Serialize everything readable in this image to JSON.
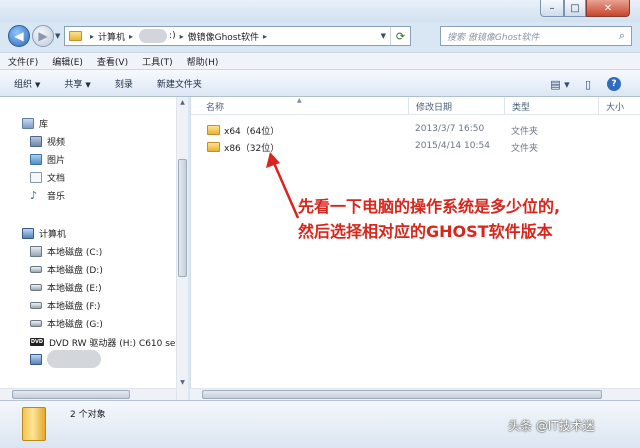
{
  "window": {
    "controls": {
      "minimize": "–",
      "maximize": "□",
      "close": "✕"
    }
  },
  "address": {
    "crumbs": [
      "计算机",
      ":)",
      "傲镜像Ghost软件"
    ],
    "refresh_icon": "refresh-icon"
  },
  "search": {
    "placeholder": "搜索 傲镜像Ghost软件"
  },
  "menubar": {
    "items": [
      "文件(F)",
      "编辑(E)",
      "查看(V)",
      "工具(T)",
      "帮助(H)"
    ]
  },
  "toolbar": {
    "organize": "组织",
    "share": "共享",
    "burn": "刻录",
    "new_folder": "新建文件夹"
  },
  "navpane": {
    "library": "库",
    "library_items": [
      "视频",
      "图片",
      "文档",
      "音乐"
    ],
    "computer": "计算机",
    "drives": [
      "本地磁盘 (C:)",
      "本地磁盘 (D:)",
      "本地磁盘 (E:)",
      "本地磁盘 (F:)",
      "本地磁盘 (G:)",
      "DVD RW 驱动器 (H:) C610 se"
    ],
    "network": "网络"
  },
  "columns": {
    "name": "名称",
    "modified": "修改日期",
    "type": "类型",
    "size": "大小"
  },
  "files": [
    {
      "name": "x64（64位）",
      "modified": "2013/3/7 16:50",
      "type": "文件夹"
    },
    {
      "name": "x86（32位）",
      "modified": "2015/4/14 10:54",
      "type": "文件夹"
    }
  ],
  "annotation": {
    "line1": "先看一下电脑的操作系统是多少位的,",
    "line2": "然后选择相对应的GHOST软件版本",
    "color": "#d8261c"
  },
  "details": {
    "count": "2 个对象"
  },
  "watermark": "头条 @IT技术迷"
}
